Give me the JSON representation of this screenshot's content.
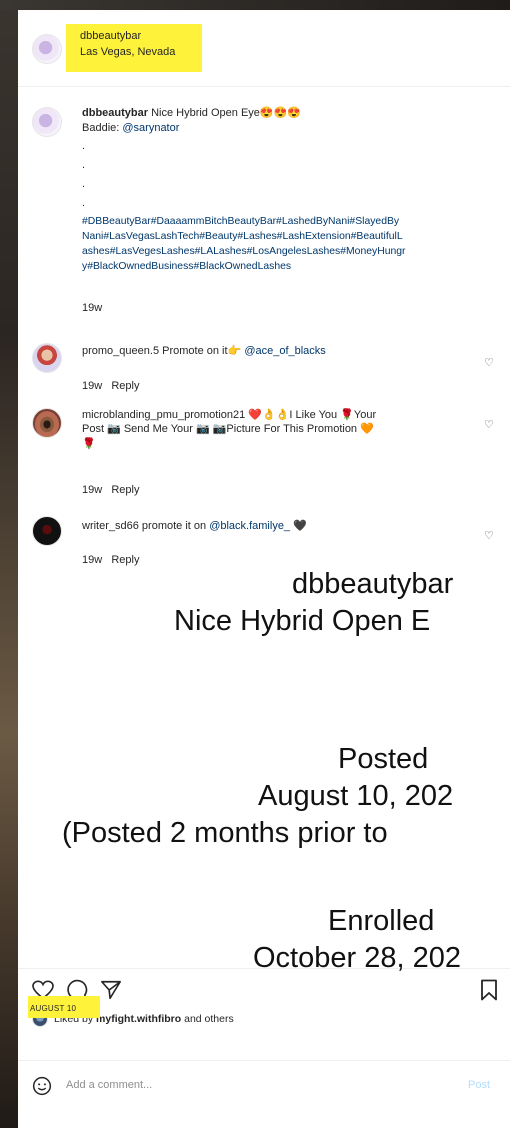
{
  "post": {
    "header": {
      "username": "dbbeautybar",
      "location": "Las Vegas, Nevada"
    },
    "caption": {
      "username": "dbbeautybar",
      "text": "Nice Hybrid Open Eye😍😍😍",
      "baddie_label": "Baddie:",
      "baddie_mention": "@sarynator",
      "hashtags_line1": "#DBBeautyBar#DaaaammBitchBeautyBar#LashedByNani#SlayedBy",
      "hashtags_line2": "Nani#LasVegasLashTech#Beauty#Lashes#LashExtension#BeautifulL",
      "hashtags_line3": "ashes#LasVegesLashes#LALashes#LosAngelesLashes#MoneyHungr",
      "hashtags_line4": "y#BlackOwnedBusiness#BlackOwnedLashes",
      "age": "19w"
    },
    "comments": [
      {
        "username": "promo_queen.5",
        "text": "Promote on it👉",
        "mention": "@ace_of_blacks",
        "age": "19w",
        "reply": "Reply"
      },
      {
        "username": "microblanding_pmu_promotion21",
        "line1": "❤️👌👌I Like You 🌹Your",
        "line2": "Post 📷 Send Me Your 📷 📷Picture For This Promotion 🧡",
        "line3": "🌹",
        "age": "19w",
        "reply": "Reply"
      },
      {
        "username": "writer_sd66",
        "text": "promote it on",
        "mention": "@black.familye_",
        "emoji": "🖤",
        "age": "19w",
        "reply": "Reply"
      }
    ],
    "likes": {
      "prefix": "Liked by",
      "user": "myfight.withfibro",
      "suffix": "and others"
    },
    "date": "AUGUST 10",
    "add_comment": {
      "placeholder": "Add a comment...",
      "post_label": "Post"
    },
    "icons": {
      "heart": "heart-icon",
      "comment": "comment-icon",
      "share": "share-icon",
      "bookmark": "bookmark-icon",
      "emoji": "emoji-icon"
    }
  },
  "overlay_annotation": {
    "line1": "dbbeautybar",
    "line2": "Nice Hybrid Open E",
    "line3": "Posted",
    "line4": "August 10, 202",
    "line5": "(Posted 2 months prior to",
    "line6": "Enrolled",
    "line7": "October 28, 202"
  },
  "highlight_color": "#fff23a"
}
